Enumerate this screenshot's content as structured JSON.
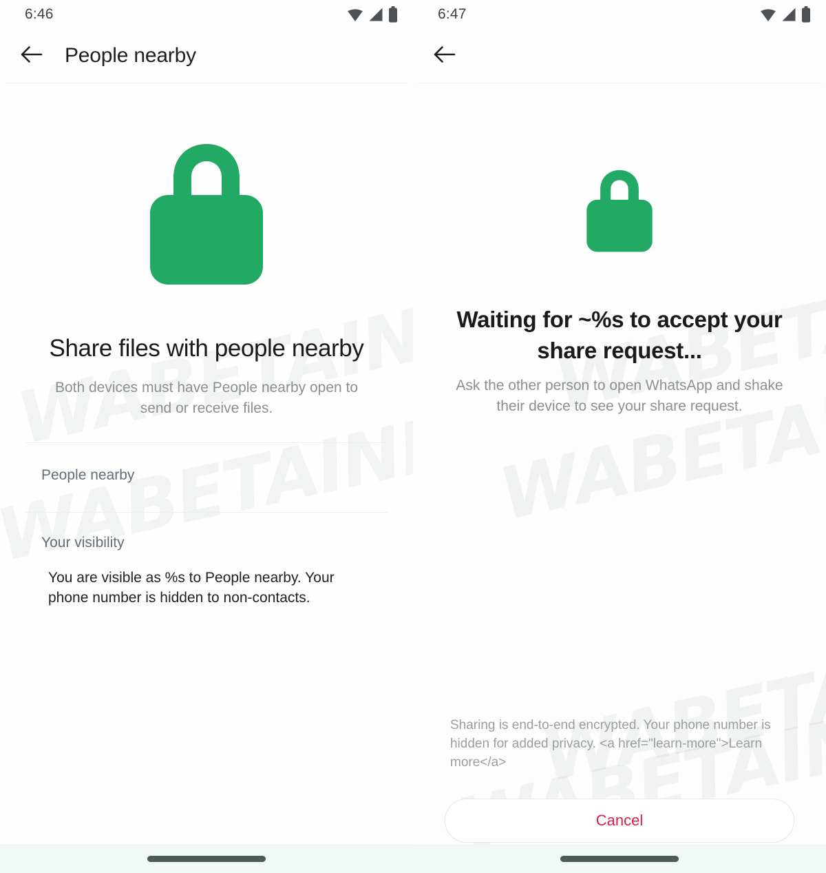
{
  "colors": {
    "lock_green": "#22a963",
    "cancel_red": "#d6214a",
    "label_blue_gray": "#5d6f77",
    "nav_bg": "#f2f8f5"
  },
  "watermark": {
    "text": "WABETAINFO"
  },
  "left_screen": {
    "status_bar": {
      "time": "6:46",
      "icons": [
        "wifi-icon",
        "cellular-signal-icon",
        "battery-icon"
      ]
    },
    "app_bar": {
      "back_icon": "back-arrow-icon",
      "title": "People nearby"
    },
    "hero": {
      "icon": "lock-icon",
      "title": "Share files with people nearby",
      "subtitle": "Both devices must have People nearby open to send or receive files."
    },
    "rows": [
      {
        "label": "People nearby"
      }
    ],
    "visibility_section": {
      "heading": "Your visibility",
      "body": "You are visible as %s to People nearby. Your phone number is hidden to non-contacts."
    }
  },
  "right_screen": {
    "status_bar": {
      "time": "6:47",
      "icons": [
        "wifi-icon",
        "cellular-signal-icon",
        "battery-icon"
      ]
    },
    "app_bar": {
      "back_icon": "back-arrow-icon",
      "title": ""
    },
    "hero": {
      "icon": "lock-icon",
      "title": "Waiting for ~%s to accept your share request...",
      "subtitle": "Ask the other person to open WhatsApp and shake their device to see your share request."
    },
    "footer_note": "Sharing is end-to-end encrypted. Your phone number is hidden for added privacy. <a href=\"learn-more\">Learn more</a>",
    "cancel_button": {
      "label": "Cancel"
    }
  }
}
